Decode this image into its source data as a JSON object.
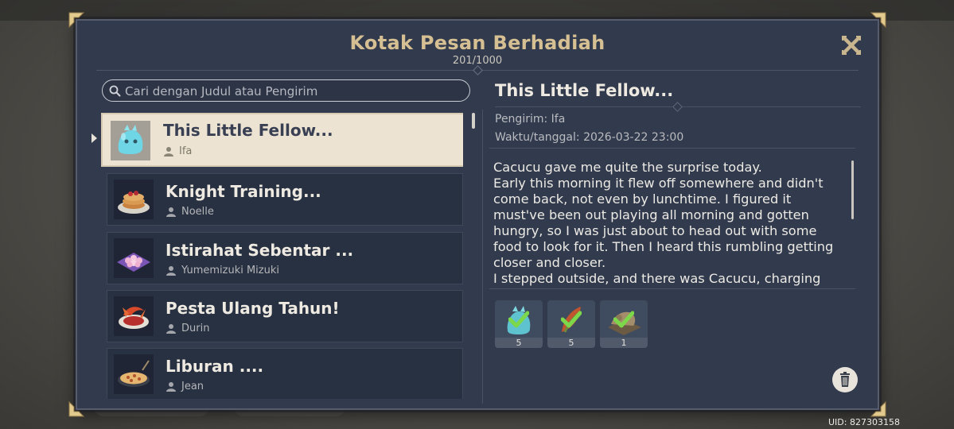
{
  "window": {
    "title": "Kotak Pesan Berhadiah",
    "count": "201/1000"
  },
  "search": {
    "placeholder": "Cari dengan Judul atau Pengirim"
  },
  "mail_list": [
    {
      "title": "This Little Fellow...",
      "sender": "Ifa",
      "icon": "slime-icon",
      "selected": true
    },
    {
      "title": "Knight Training...",
      "sender": "Noelle",
      "icon": "pancake-dish-icon"
    },
    {
      "title": "Istirahat Sebentar ...",
      "sender": "Yumemizuki Mizuki",
      "icon": "dango-tray-icon"
    },
    {
      "title": "Pesta Ulang Tahun!",
      "sender": "Durin",
      "icon": "dragon-dish-icon"
    },
    {
      "title": "Liburan ....",
      "sender": "Jean",
      "icon": "pizza-dish-icon"
    }
  ],
  "detail": {
    "title": "This Little Fellow...",
    "sender": "Pengirim: Ifa",
    "datetime": "Waktu/tanggal: 2026-03-22 23:00",
    "body": "Cacucu gave me quite the surprise today.\nEarly this morning it flew off somewhere and didn't come back, not even by lunchtime. I figured it must've been out playing all morning and gotten hungry, so I was just about to head out with some food to look for it. Then I heard this rumbling getting closer and closer.\nI stepped outside, and there was Cacucu, charging"
  },
  "rewards": [
    {
      "qty": "5",
      "icon": "slime-icon",
      "claimed": true
    },
    {
      "qty": "5",
      "icon": "leaf-material-icon",
      "claimed": true
    },
    {
      "qty": "1",
      "icon": "furnishing-icon",
      "claimed": true
    }
  ],
  "footer": {
    "uid": "UID: 827303158"
  },
  "colors": {
    "panel_bg": "#323a4d",
    "title_gold": "#d5bf93",
    "selected_bg": "#ece3d2",
    "item_bg": "#283142",
    "check_green": "#7cd84a"
  }
}
